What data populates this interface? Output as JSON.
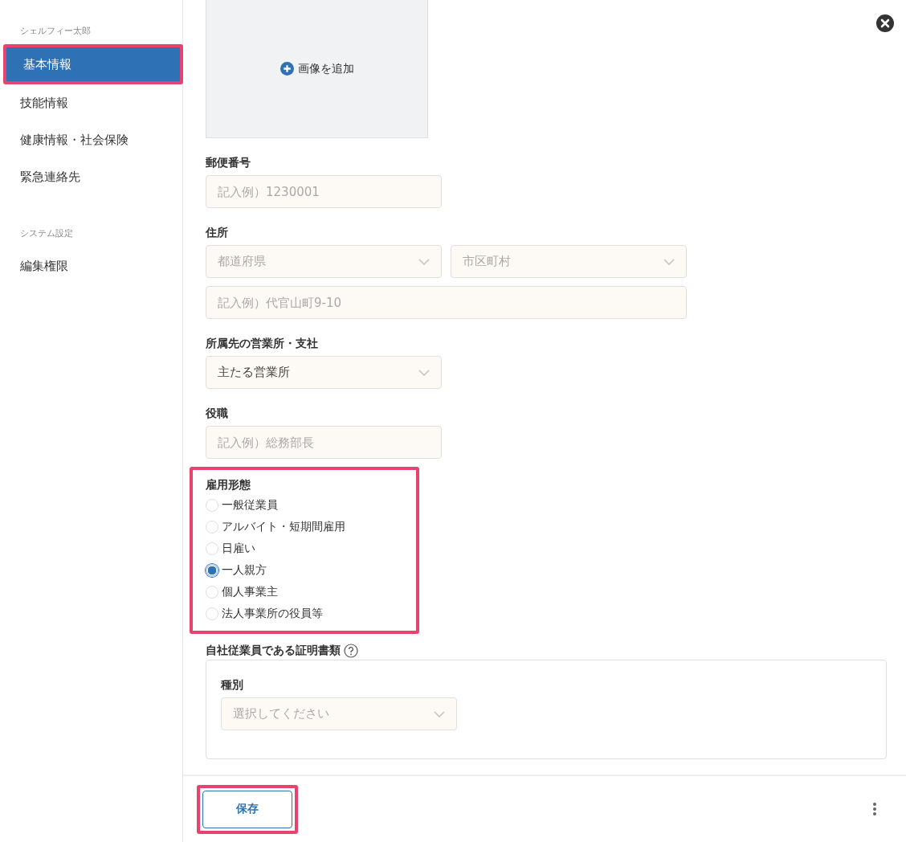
{
  "sidebar": {
    "sections": [
      {
        "title": "シェルフィー太郎",
        "items": [
          {
            "label": "基本情報",
            "selected": true,
            "highlighted": true
          },
          {
            "label": "技能情報",
            "selected": false,
            "highlighted": false
          },
          {
            "label": "健康情報・社会保険",
            "selected": false,
            "highlighted": false
          },
          {
            "label": "緊急連絡先",
            "selected": false,
            "highlighted": false
          }
        ]
      },
      {
        "title": "システム設定",
        "items": [
          {
            "label": "編集権限",
            "selected": false,
            "highlighted": false
          }
        ]
      }
    ]
  },
  "image_upload": {
    "label": "画像を追加"
  },
  "fields": [
    {
      "kind": "text",
      "label": "郵便番号",
      "placeholder": "記入例）1230001"
    },
    {
      "kind": "address",
      "label": "住所",
      "selects": [
        {
          "placeholder": "都道府県"
        },
        {
          "placeholder": "市区町村"
        }
      ],
      "input": {
        "placeholder": "記入例）代官山町9-10"
      }
    },
    {
      "kind": "select",
      "label": "所属先の営業所・支社",
      "value": "主たる営業所"
    },
    {
      "kind": "text",
      "label": "役職",
      "placeholder": "記入例）総務部長"
    },
    {
      "kind": "radio",
      "label": "雇用形態",
      "highlighted": true,
      "options": [
        {
          "label": "一般従業員",
          "selected": false
        },
        {
          "label": "アルバイト・短期間雇用",
          "selected": false
        },
        {
          "label": "日雇い",
          "selected": false
        },
        {
          "label": "一人親方",
          "selected": true
        },
        {
          "label": "個人事業主",
          "selected": false
        },
        {
          "label": "法人事業所の役員等",
          "selected": false
        }
      ]
    },
    {
      "kind": "group",
      "label": "自社従業員である証明書類",
      "help": true,
      "sub_label": "種別",
      "select": {
        "placeholder": "選択してください"
      }
    }
  ],
  "footer": {
    "save_button": {
      "label": "保存",
      "highlighted": true
    }
  }
}
